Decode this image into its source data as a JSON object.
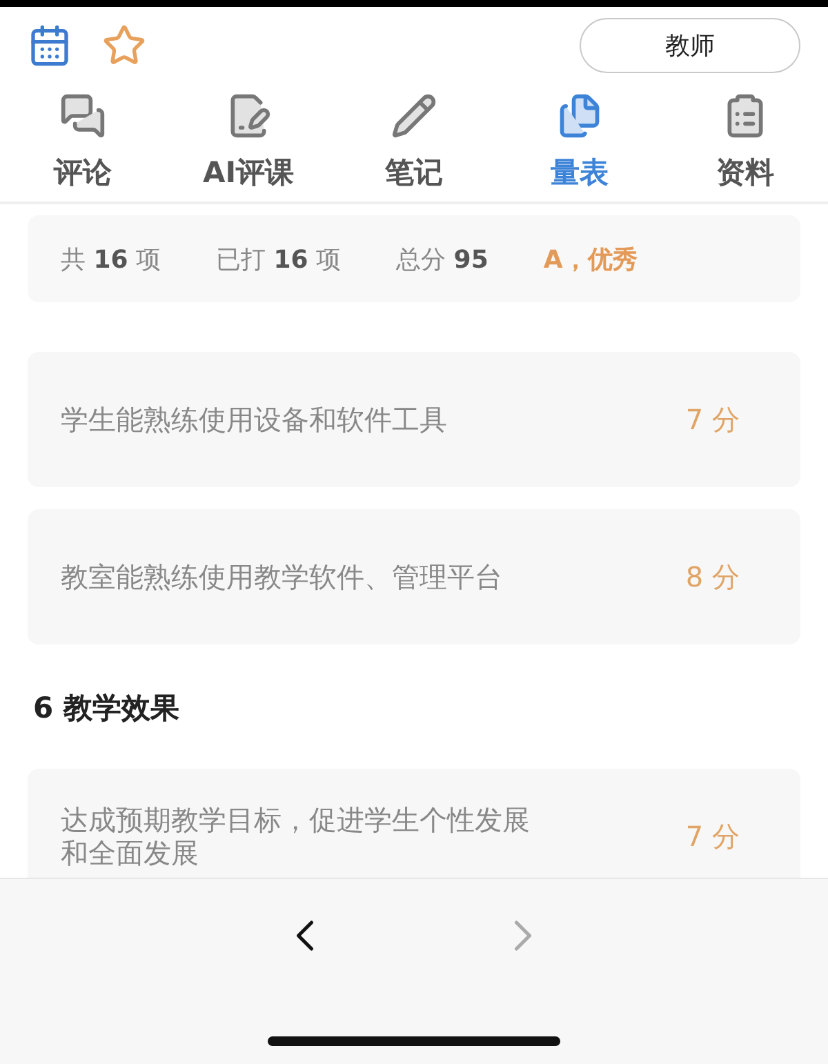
{
  "header": {
    "role_button": "教师"
  },
  "tabs": [
    {
      "label": "评论",
      "selected": false
    },
    {
      "label": "AI评课",
      "selected": false
    },
    {
      "label": "笔记",
      "selected": false
    },
    {
      "label": "量表",
      "selected": true
    },
    {
      "label": "资料",
      "selected": false
    }
  ],
  "summary": {
    "parts": [
      "共 **16** 项",
      "已打 **16** 项",
      "总分 **95**"
    ],
    "grade": "A，优秀"
  },
  "rows": [
    {
      "kind": "item",
      "text": "学生能熟练使用设备和软件工具",
      "score": "7 分"
    },
    {
      "kind": "item",
      "text": "教室能熟练使用教学软件、管理平台",
      "score": "8 分"
    },
    {
      "kind": "heading",
      "text": "6 教学效果"
    },
    {
      "kind": "item",
      "text": "达成预期教学目标，促进学生个性发展和全面发展",
      "score": "7 分"
    }
  ],
  "nav": {
    "prev_disabled": false,
    "next_disabled": true
  }
}
